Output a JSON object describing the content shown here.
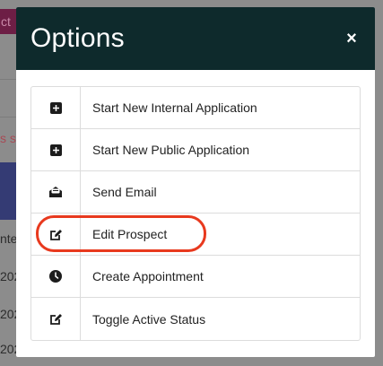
{
  "background": {
    "badge_text": "ct",
    "red_text": "s s",
    "cells": [
      "nte",
      "202",
      "202",
      "202"
    ]
  },
  "modal": {
    "title": "Options",
    "close_label": "×"
  },
  "options": [
    {
      "label": "Start New Internal Application",
      "icon": "plus-square-icon"
    },
    {
      "label": "Start New Public Application",
      "icon": "plus-square-icon"
    },
    {
      "label": "Send Email",
      "icon": "envelope-open-icon"
    },
    {
      "label": "Edit Prospect",
      "icon": "edit-icon"
    },
    {
      "label": "Create Appointment",
      "icon": "clock-icon"
    },
    {
      "label": "Toggle Active Status",
      "icon": "edit-icon"
    }
  ],
  "colors": {
    "header_bg": "#0e2a2c",
    "highlight": "#e8391e"
  }
}
